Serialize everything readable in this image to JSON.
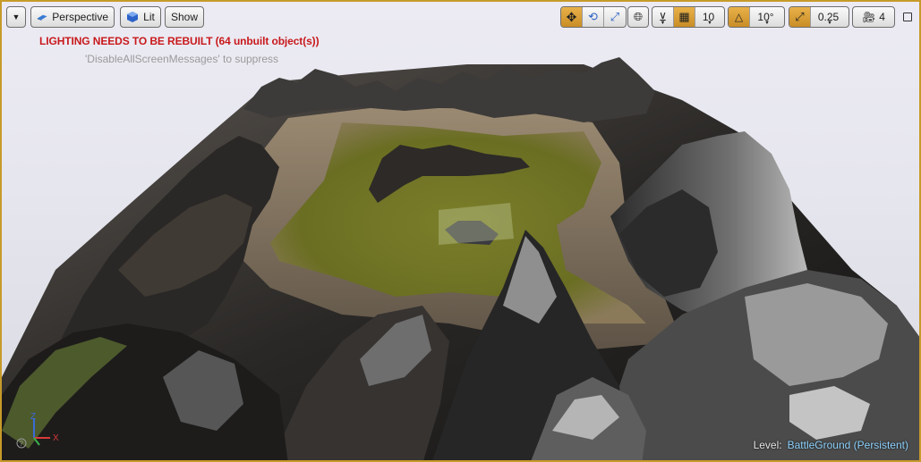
{
  "toolbar": {
    "menu_icon": "chevron-down-icon",
    "perspective_label": "Perspective",
    "lit_label": "Lit",
    "show_label": "Show",
    "grid_size": "10",
    "rotation_snap": "10°",
    "scale_snap": "0.25",
    "camera_speed": "4"
  },
  "messages": {
    "lighting_warning": "LIGHTING NEEDS TO BE REBUILT (64 unbuilt object(s))",
    "suppress_hint": "'DisableAllScreenMessages' to suppress"
  },
  "status": {
    "level_label": "Level:",
    "level_name": "BattleGround (Persistent)"
  },
  "axis": {
    "z": "Z",
    "x": "X"
  },
  "colors": {
    "accent": "#c79a2a",
    "warning": "#c8191c",
    "level_name": "#8fd3ff",
    "grass": "#6f7424",
    "sky": "#e6e6ee"
  }
}
